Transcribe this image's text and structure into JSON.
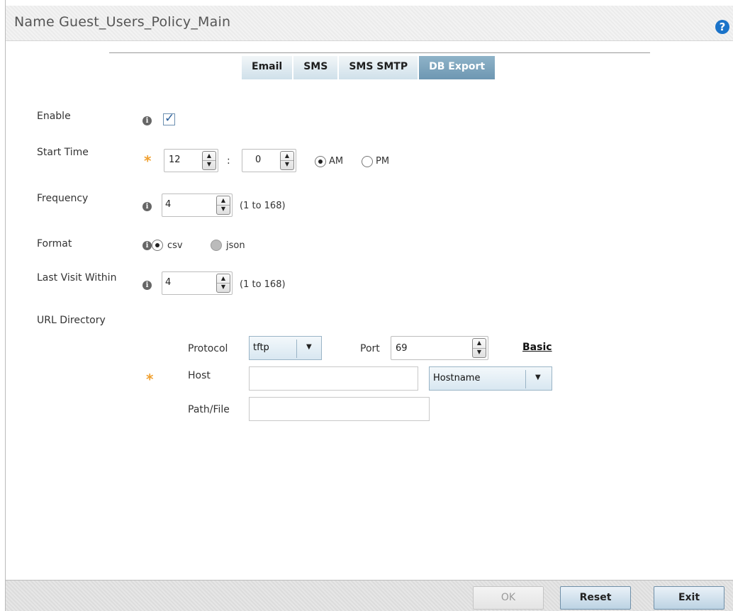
{
  "header": {
    "title": "Name  Guest_Users_Policy_Main",
    "help_icon": "question-circle-icon"
  },
  "tabs": [
    {
      "label": "Email",
      "active": false
    },
    {
      "label": "SMS",
      "active": false
    },
    {
      "label": "SMS SMTP",
      "active": false
    },
    {
      "label": "DB Export",
      "active": true
    }
  ],
  "form": {
    "enable": {
      "label": "Enable",
      "checked": true
    },
    "start_time": {
      "label": "Start Time",
      "hour": "12",
      "separator": ":",
      "minute": "0",
      "am_label": "AM",
      "pm_label": "PM",
      "selected": "AM"
    },
    "frequency": {
      "label": "Frequency",
      "value": "4",
      "range": "(1 to 168)"
    },
    "format": {
      "label": "Format",
      "csv_label": "csv",
      "json_label": "json",
      "selected": "csv"
    },
    "last_visit": {
      "label": "Last Visit Within",
      "value": "4",
      "range": "(1 to 168)"
    },
    "url_directory": {
      "label": "URL Directory",
      "protocol_label": "Protocol",
      "protocol_value": "tftp",
      "port_label": "Port",
      "port_value": "69",
      "basic_link": "Basic",
      "host_label": "Host",
      "host_value": "",
      "host_type": "Hostname",
      "path_label": "Path/File",
      "path_value": ""
    }
  },
  "footer": {
    "ok_label": "OK",
    "reset_label": "Reset",
    "exit_label": "Exit"
  },
  "colors": {
    "accent": "#1a73c9",
    "required_star": "#f0a030",
    "tab_active": "#7a9fb9"
  }
}
